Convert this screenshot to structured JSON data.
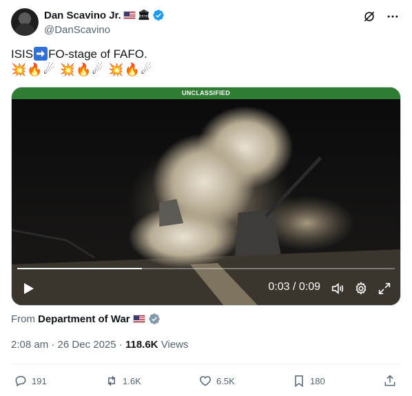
{
  "author": {
    "name": "Dan Scavino Jr.",
    "name_emoji": "🏛",
    "handle": "@DanScavino"
  },
  "post": {
    "text_prefix": "ISIS",
    "arrow_emoji": "➡",
    "text_suffix": "FO-stage of FAFO.",
    "emoji_line": "💥🔥☄ 💥🔥☄ 💥🔥☄"
  },
  "media": {
    "banner": "UNCLASSIFIED",
    "timecode": "0:03 / 0:09",
    "progress": 0.33
  },
  "source": {
    "from_label": "From",
    "account": "Department of War"
  },
  "meta": {
    "time": "2:08 am",
    "sep1": "·",
    "date": "26 Dec 2025",
    "sep2": "·",
    "views_count": "118.6K",
    "views_label": "Views"
  },
  "actions": {
    "replies": "191",
    "reposts": "1.6K",
    "likes": "6.5K",
    "bookmarks": "180"
  },
  "colors": {
    "verified_blue": "#1d9bf0",
    "verified_gray": "#829aab",
    "banner_green": "#2e7d32",
    "muted": "#536471"
  }
}
